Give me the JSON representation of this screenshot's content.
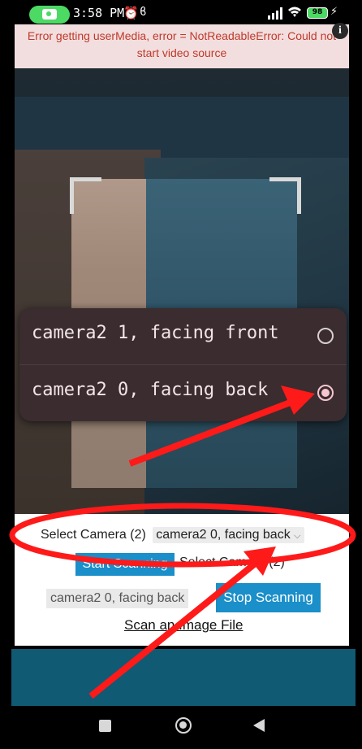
{
  "status_bar": {
    "time": "3:58 PM",
    "alarm_icon": "alarm-clock-icon",
    "extra_glyph": "ϐ",
    "battery": "98",
    "icons": [
      "screenshot-icon",
      "signal-icon",
      "wifi-icon",
      "battery-icon",
      "charging-bolt-icon"
    ]
  },
  "error": {
    "message": "Error getting userMedia, error = NotReadableError: Could not start video source"
  },
  "camera_popup": {
    "options": [
      {
        "label": "camera2 1, facing front",
        "selected": false
      },
      {
        "label": "camera2 0, facing back",
        "selected": true
      }
    ]
  },
  "controls": {
    "select_camera_label": "Select Camera (2)",
    "camera_select_value": "camera2 0, facing back",
    "start_scanning": "Start Scanning",
    "select_camera_label_overlap": "Select Camera (2)",
    "camera_value_chip": "camera2 0, facing back",
    "stop_scanning": "Stop Scanning",
    "scan_image_file": "Scan an Image File"
  },
  "colors": {
    "error_text": "#c0392b",
    "error_bg": "#f2dede",
    "button_blue": "#1a8fc9",
    "popup_bg": "#3a2c2f",
    "annotation_red": "#ff1a1a",
    "bottom_bar": "#105a73"
  },
  "nav_bar": {
    "icons": [
      "recents-square-icon",
      "home-circle-icon",
      "back-triangle-icon"
    ]
  }
}
